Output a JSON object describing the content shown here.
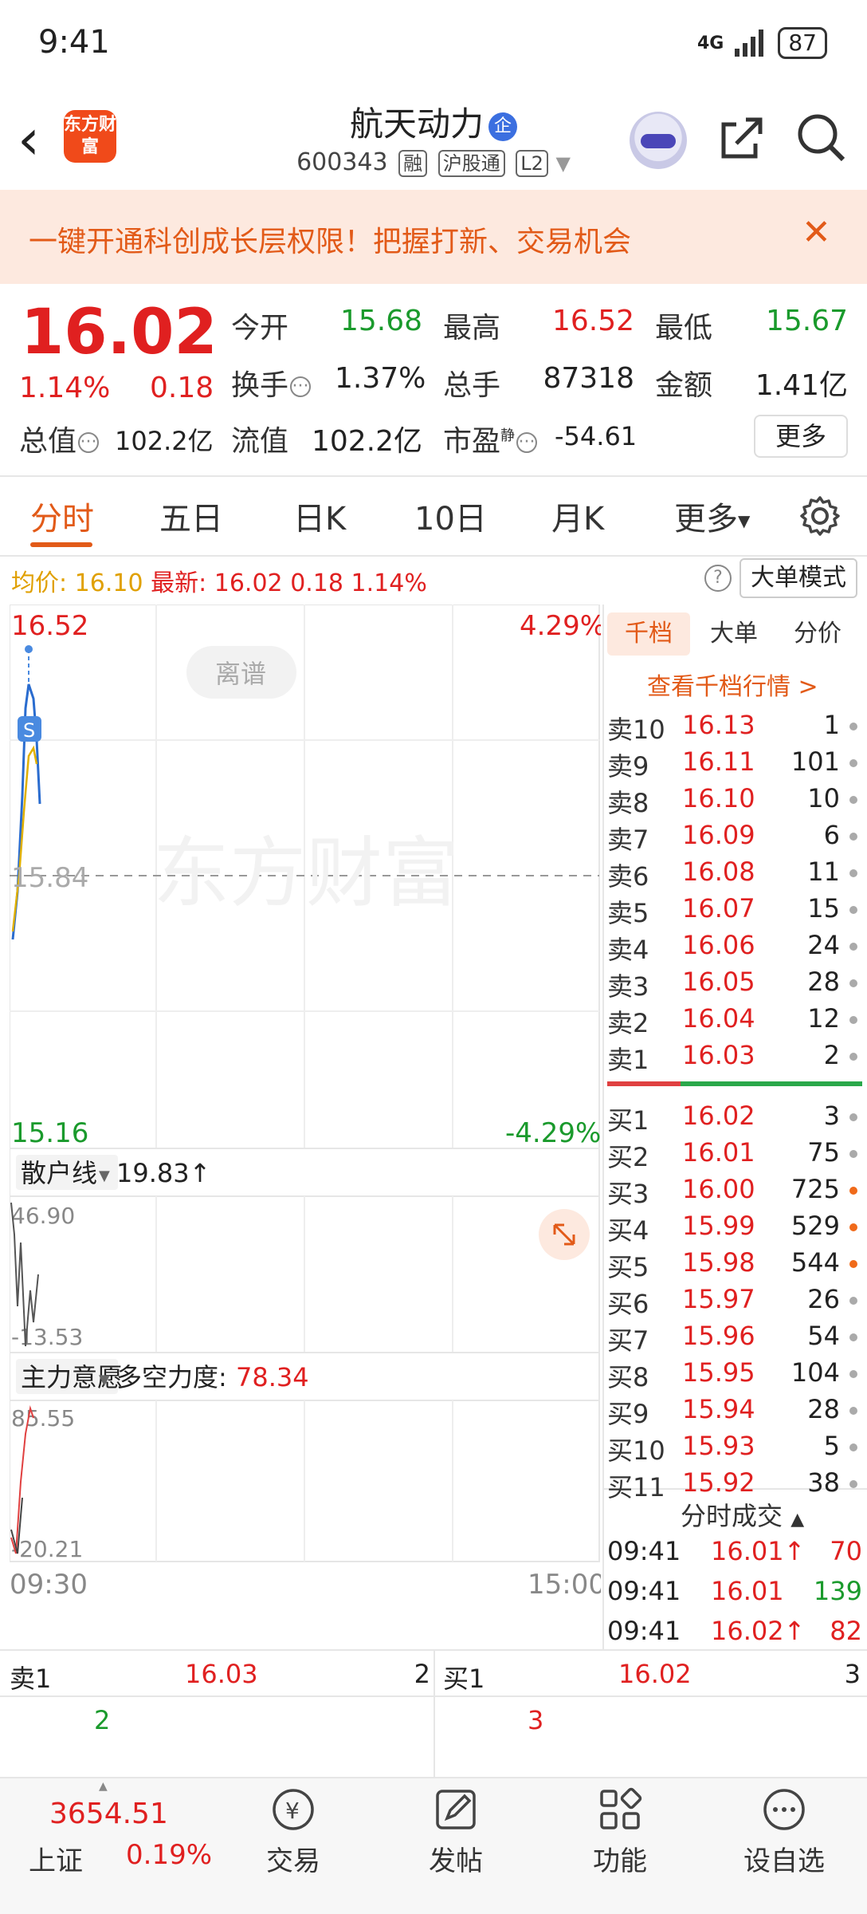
{
  "status": {
    "time": "9:41",
    "network": "4G",
    "battery": "87"
  },
  "header": {
    "title": "航天动力",
    "title_badge": "企",
    "code": "600343",
    "tags": [
      "融",
      "沪股通",
      "L2"
    ],
    "logo_text": "东方财富"
  },
  "promo": {
    "text": "一键开通科创成长层权限！把握打新、交易机会",
    "close": "✕"
  },
  "quote": {
    "price": "16.02",
    "change_pct": "1.14%",
    "change": "0.18",
    "open_label": "今开",
    "open": "15.68",
    "high_label": "最高",
    "high": "16.52",
    "low_label": "最低",
    "low": "15.67",
    "turnover_label": "换手",
    "turnover": "1.37%",
    "volume_label": "总手",
    "volume": "87318",
    "amount_label": "金额",
    "amount": "1.41亿",
    "mktcap_label": "总值",
    "mktcap": "102.2亿",
    "float_label": "流值",
    "float": "102.2亿",
    "pe_label": "市盈",
    "pe_sup": "静",
    "pe": "-54.61",
    "more_label": "更多"
  },
  "tabs": [
    "分时",
    "五日",
    "日K",
    "10日",
    "月K",
    "更多"
  ],
  "avg_row": {
    "avg_label": "均价:",
    "avg_value": "16.10",
    "latest_label": "最新:",
    "latest_value": "16.02",
    "latest_change": "0.18",
    "latest_pct": "1.14%",
    "mode_button": "大单模式"
  },
  "chart": {
    "top_price": "16.52",
    "top_pct": "4.29%",
    "mid_price": "15.84",
    "bottom_price": "15.16",
    "bottom_pct": "-4.29%",
    "watermark": "东方财富",
    "tag_liqu": "离谱",
    "s_marker": "S",
    "sub1_label": "散户线",
    "sub1_value": "19.83↑",
    "sub1_max": "46.90",
    "sub1_min": "-13.53",
    "sub2_label": "主力意愿",
    "sub2_metric": "多空力度:",
    "sub2_value": "78.34",
    "sub2_max": "85.55",
    "sub2_min": "-20.21",
    "time_start": "09:30",
    "time_end": "15:00"
  },
  "orderbook": {
    "tabs": [
      "千档",
      "大单",
      "分价"
    ],
    "link": "查看千档行情 >",
    "asks": [
      {
        "label": "卖10",
        "price": "16.13",
        "qty": "1",
        "dot": "gray"
      },
      {
        "label": "卖9",
        "price": "16.11",
        "qty": "101",
        "dot": "gray"
      },
      {
        "label": "卖8",
        "price": "16.10",
        "qty": "10",
        "dot": "gray"
      },
      {
        "label": "卖7",
        "price": "16.09",
        "qty": "6",
        "dot": "gray"
      },
      {
        "label": "卖6",
        "price": "16.08",
        "qty": "11",
        "dot": "gray"
      },
      {
        "label": "卖5",
        "price": "16.07",
        "qty": "15",
        "dot": "gray"
      },
      {
        "label": "卖4",
        "price": "16.06",
        "qty": "24",
        "dot": "gray"
      },
      {
        "label": "卖3",
        "price": "16.05",
        "qty": "28",
        "dot": "gray"
      },
      {
        "label": "卖2",
        "price": "16.04",
        "qty": "12",
        "dot": "gray"
      },
      {
        "label": "卖1",
        "price": "16.03",
        "qty": "2",
        "dot": "gray"
      }
    ],
    "bids": [
      {
        "label": "买1",
        "price": "16.02",
        "qty": "3",
        "dot": "gray"
      },
      {
        "label": "买2",
        "price": "16.01",
        "qty": "75",
        "dot": "gray"
      },
      {
        "label": "买3",
        "price": "16.00",
        "qty": "725",
        "dot": "orange"
      },
      {
        "label": "买4",
        "price": "15.99",
        "qty": "529",
        "dot": "orange"
      },
      {
        "label": "买5",
        "price": "15.98",
        "qty": "544",
        "dot": "orange"
      },
      {
        "label": "买6",
        "price": "15.97",
        "qty": "26",
        "dot": "gray"
      },
      {
        "label": "买7",
        "price": "15.96",
        "qty": "54",
        "dot": "gray"
      },
      {
        "label": "买8",
        "price": "15.95",
        "qty": "104",
        "dot": "gray"
      },
      {
        "label": "买9",
        "price": "15.94",
        "qty": "28",
        "dot": "gray"
      },
      {
        "label": "买10",
        "price": "15.93",
        "qty": "5",
        "dot": "gray"
      },
      {
        "label": "买11",
        "price": "15.92",
        "qty": "38",
        "dot": "gray"
      }
    ],
    "ticks_title": "分时成交",
    "ticks": [
      {
        "time": "09:41",
        "price": "16.01↑",
        "vol": "70",
        "price_color": "red",
        "vol_color": "red"
      },
      {
        "time": "09:41",
        "price": "16.01",
        "vol": "139",
        "price_color": "red",
        "vol_color": "green"
      },
      {
        "time": "09:41",
        "price": "16.02↑",
        "vol": "82",
        "price_color": "red",
        "vol_color": "red"
      }
    ]
  },
  "quick": {
    "sell_label": "卖1",
    "sell_price": "16.03",
    "sell_qty": "2",
    "sell_sub": "2",
    "buy_label": "买1",
    "buy_price": "16.02",
    "buy_qty": "3",
    "buy_sub": "3"
  },
  "bottom_nav": {
    "index_value": "3654.51",
    "index_name": "上证",
    "index_pct": "0.19%",
    "items": [
      "交易",
      "发帖",
      "功能",
      "设自选"
    ]
  },
  "colors": {
    "up": "#e02020",
    "down": "#1a9a2c",
    "accent": "#e25a18"
  }
}
